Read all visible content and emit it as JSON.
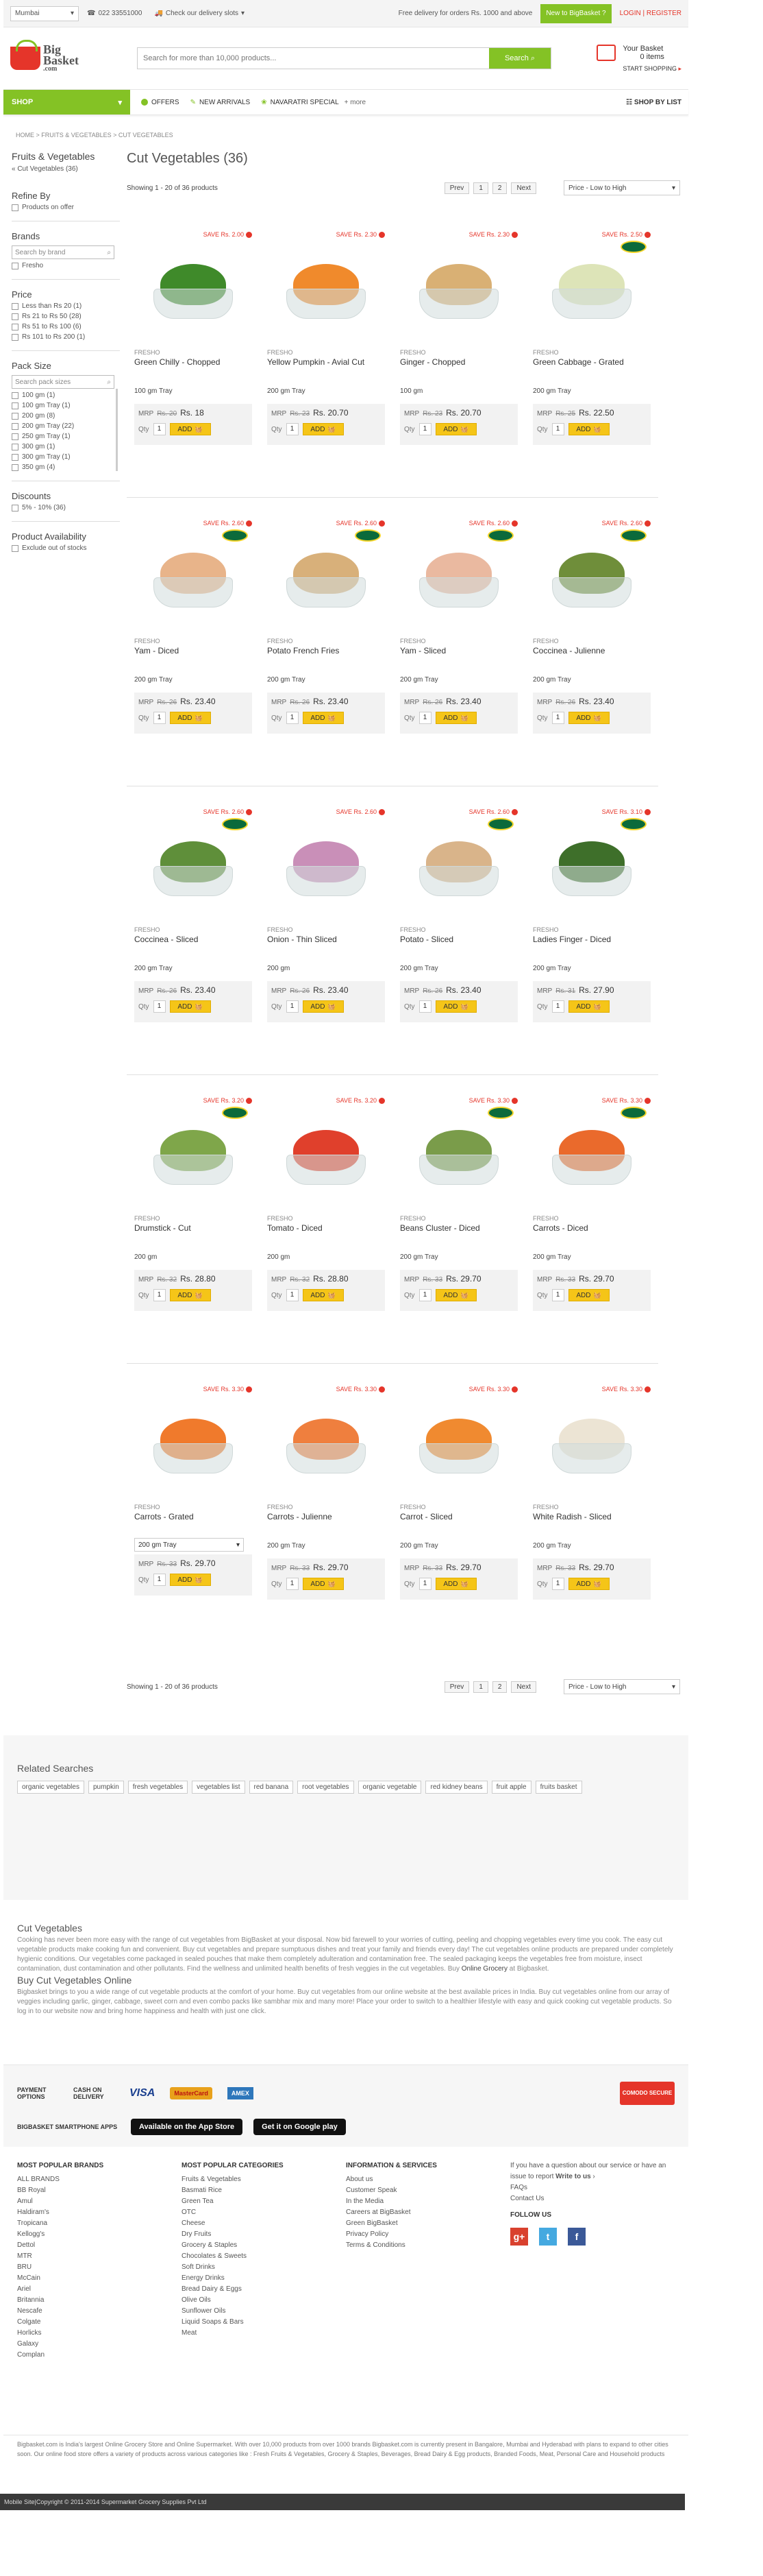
{
  "topbar": {
    "city": "Mumbai",
    "phone": "022 33551000",
    "delivery": "Check our delivery slots",
    "free": "Free delivery for orders Rs. 1000 and above",
    "new_btn": "New to BigBasket ?",
    "login": "LOGIN",
    "sep": " | ",
    "register": "REGISTER"
  },
  "logo": {
    "line1": "Big",
    "line2": "Basket",
    "line3": ".com"
  },
  "search": {
    "placeholder": "Search for more than 10,000 products...",
    "button": "Search"
  },
  "cart": {
    "title": "Your Basket",
    "items": "0 items",
    "start": "START SHOPPING"
  },
  "nav": {
    "shop": "SHOP",
    "offers": "OFFERS",
    "arrivals": "NEW ARRIVALS",
    "special": "NAVARATRI SPECIAL",
    "more": "+ more",
    "list": "SHOP BY LIST"
  },
  "breadcrumb": {
    "home": "HOME",
    "cat": "FRUITS & VEGETABLES",
    "sub": "CUT VEGETABLES",
    "sep": " > "
  },
  "sidebar": {
    "title": "Fruits & Vegetables",
    "sub": "« Cut Vegetables (36)",
    "refine": "Refine By",
    "offer": "Products on offer",
    "brands": "Brands",
    "brand_search": "Search by brand",
    "brand_list": [
      "Fresho"
    ],
    "price": "Price",
    "prices": [
      "Less than Rs 20 (1)",
      "Rs 21 to Rs 50 (28)",
      "Rs 51 to Rs 100 (6)",
      "Rs 101 to Rs 200 (1)"
    ],
    "pack": "Pack Size",
    "pack_search": "Search pack sizes",
    "packs": [
      "100 gm (1)",
      "100 gm Tray (1)",
      "200 gm (8)",
      "200 gm Tray (22)",
      "250 gm Tray (1)",
      "300 gm (1)",
      "300 gm Tray (1)",
      "350 gm (4)"
    ],
    "discounts": "Discounts",
    "discount_list": [
      "5% - 10% (36)"
    ],
    "avail": "Product Availability",
    "exclude": "Exclude out of stocks"
  },
  "content": {
    "title": "Cut Vegetables (36)",
    "showing": "Showing 1 - 20 of 36 products",
    "prev": "Prev",
    "p1": "1",
    "p2": "2",
    "next": "Next",
    "sort": "Price - Low to High"
  },
  "labels": {
    "mrp": "MRP",
    "qty": "Qty",
    "qty_val": "1",
    "add": "ADD"
  },
  "products": [
    {
      "save": "SAVE Rs. 2.00",
      "brand": "FRESHO",
      "name": "Green Chilly - Chopped",
      "size": "100 gm Tray",
      "mrp": "Rs. 20",
      "price": "Rs. 18",
      "color": "#3f8a2a",
      "badge": false
    },
    {
      "save": "SAVE Rs. 2.30",
      "brand": "FRESHO",
      "name": "Yellow Pumpkin - Avial Cut",
      "size": "200 gm Tray",
      "mrp": "Rs. 23",
      "price": "Rs. 20.70",
      "color": "#f08a2c",
      "badge": false
    },
    {
      "save": "SAVE Rs. 2.30",
      "brand": "FRESHO",
      "name": "Ginger - Chopped",
      "size": "100 gm",
      "mrp": "Rs. 23",
      "price": "Rs. 20.70",
      "color": "#d9b074",
      "badge": false
    },
    {
      "save": "SAVE Rs. 2.50",
      "brand": "FRESHO",
      "name": "Green Cabbage - Grated",
      "size": "200 gm Tray",
      "mrp": "Rs. 25",
      "price": "Rs. 22.50",
      "color": "#dde4b8",
      "badge": true
    },
    {
      "save": "SAVE Rs. 2.60",
      "brand": "FRESHO",
      "name": "Yam - Diced",
      "size": "200 gm Tray",
      "mrp": "Rs. 26",
      "price": "Rs. 23.40",
      "color": "#e8b48a",
      "badge": true
    },
    {
      "save": "SAVE Rs. 2.60",
      "brand": "FRESHO",
      "name": "Potato French Fries",
      "size": "200 gm Tray",
      "mrp": "Rs. 26",
      "price": "Rs. 23.40",
      "color": "#d8b07a",
      "badge": true
    },
    {
      "save": "SAVE Rs. 2.60",
      "brand": "FRESHO",
      "name": "Yam - Sliced",
      "size": "200 gm Tray",
      "mrp": "Rs. 26",
      "price": "Rs. 23.40",
      "color": "#eab9a0",
      "badge": true
    },
    {
      "save": "SAVE Rs. 2.60",
      "brand": "FRESHO",
      "name": "Coccinea - Julienne",
      "size": "200 gm Tray",
      "mrp": "Rs. 26",
      "price": "Rs. 23.40",
      "color": "#6f8e3a",
      "badge": true
    },
    {
      "save": "SAVE Rs. 2.60",
      "brand": "FRESHO",
      "name": "Coccinea - Sliced",
      "size": "200 gm Tray",
      "mrp": "Rs. 26",
      "price": "Rs. 23.40",
      "color": "#5f8f3a",
      "badge": true
    },
    {
      "save": "SAVE Rs. 2.60",
      "brand": "FRESHO",
      "name": "Onion - Thin Sliced",
      "size": "200 gm",
      "mrp": "Rs. 26",
      "price": "Rs. 23.40",
      "color": "#c98fb8",
      "badge": false
    },
    {
      "save": "SAVE Rs. 2.60",
      "brand": "FRESHO",
      "name": "Potato - Sliced",
      "size": "200 gm Tray",
      "mrp": "Rs. 26",
      "price": "Rs. 23.40",
      "color": "#d9b48a",
      "badge": true
    },
    {
      "save": "SAVE Rs. 3.10",
      "brand": "FRESHO",
      "name": "Ladies Finger - Diced",
      "size": "200 gm Tray",
      "mrp": "Rs. 31",
      "price": "Rs. 27.90",
      "color": "#3e6f2a",
      "badge": true
    },
    {
      "save": "SAVE Rs. 3.20",
      "brand": "FRESHO",
      "name": "Drumstick - Cut",
      "size": "200 gm",
      "mrp": "Rs. 32",
      "price": "Rs. 28.80",
      "color": "#7fa64a",
      "badge": true
    },
    {
      "save": "SAVE Rs. 3.20",
      "brand": "FRESHO",
      "name": "Tomato - Diced",
      "size": "200 gm",
      "mrp": "Rs. 32",
      "price": "Rs. 28.80",
      "color": "#e0402c",
      "badge": false
    },
    {
      "save": "SAVE Rs. 3.30",
      "brand": "FRESHO",
      "name": "Beans Cluster - Diced",
      "size": "200 gm Tray",
      "mrp": "Rs. 33",
      "price": "Rs. 29.70",
      "color": "#7a9c4a",
      "badge": true
    },
    {
      "save": "SAVE Rs. 3.30",
      "brand": "FRESHO",
      "name": "Carrots - Diced",
      "size": "200 gm Tray",
      "mrp": "Rs. 33",
      "price": "Rs. 29.70",
      "color": "#ea6a2c",
      "badge": true
    },
    {
      "save": "SAVE Rs. 3.30",
      "brand": "FRESHO",
      "name": "Carrots - Grated",
      "size": "200 gm Tray",
      "mrp": "Rs. 33",
      "price": "Rs. 29.70",
      "color": "#f07a2c",
      "badge": false,
      "select": true
    },
    {
      "save": "SAVE Rs. 3.30",
      "brand": "FRESHO",
      "name": "Carrots - Julienne",
      "size": "200 gm Tray",
      "mrp": "Rs. 33",
      "price": "Rs. 29.70",
      "color": "#ef7f3e",
      "badge": false
    },
    {
      "save": "SAVE Rs. 3.30",
      "brand": "FRESHO",
      "name": "Carrot - Sliced",
      "size": "200 gm Tray",
      "mrp": "Rs. 33",
      "price": "Rs. 29.70",
      "color": "#f08a30",
      "badge": false
    },
    {
      "save": "SAVE Rs. 3.30",
      "brand": "FRESHO",
      "name": "White Radish - Sliced",
      "size": "200 gm Tray",
      "mrp": "Rs. 33",
      "price": "Rs. 29.70",
      "color": "#ece4d4",
      "badge": false
    }
  ],
  "related": {
    "title": "Related Searches",
    "tags": [
      "organic vegetables",
      "pumpkin",
      "fresh vegetables",
      "vegetables list",
      "red banana",
      "root vegetables",
      "organic vegetable",
      "red kidney beans",
      "fruit apple",
      "fruits basket"
    ]
  },
  "about": {
    "title1": "Cut Vegetables",
    "text1": "Cooking has never been more easy with the range of cut vegetables from BigBasket at your disposal. Now bid farewell to your worries of cutting, peeling and chopping vegetables every time you cook. The easy cut vegetable products make cooking fun and convenient. Buy cut vegetables and prepare sumptuous dishes and treat your family and friends every day! The cut vegetables online products are prepared under completely hygienic conditions. Our vegetables come packaged in sealed pouches that make them completely adulteration and contamination free. The sealed packaging keeps the vegetables free from moisture, insect contamination, dust contamination and other pollutants. Find the wellness and unlimited health benefits of fresh veggies in the cut vegetables. Buy",
    "link1": "Online Grocery",
    "text1b": " at Bigbasket.",
    "title2": "Buy Cut Vegetables Online",
    "text2": "Bigbasket brings to you a wide range of cut vegetable products at the comfort of your home. Buy cut vegetables from our online website at the best available prices in India. Buy cut vegetables online from our array of veggies including garlic, ginger, cabbage, sweet corn and even combo packs like sambhar mix and many more! Place your order to switch to a healthier lifestyle with easy and quick cooking cut vegetable products. So log in to our website now and bring home happiness and health with just one click."
  },
  "payment": {
    "label": "PAYMENT OPTIONS",
    "cod": "CASH ON DELIVERY",
    "visa": "VISA",
    "mc": "MasterCard",
    "amex": "AMEX",
    "secure": "COMODO SECURE",
    "apps": "BIGBASKET SMARTPHONE APPS",
    "appstore": "Available on the App Store",
    "play": "Get it on Google play"
  },
  "footer": {
    "brands_title": "MOST POPULAR BRANDS",
    "brands": [
      "ALL BRANDS",
      "BB Royal",
      "Amul",
      "Haldiram's",
      "Tropicana",
      "Kellogg's",
      "Dettol",
      "MTR",
      "BRU",
      "McCain",
      "Ariel",
      "Britannia",
      "Nescafe",
      "Colgate",
      "Horlicks",
      "Galaxy",
      "Complan"
    ],
    "cats_title": "MOST POPULAR CATEGORIES",
    "cats": [
      "Fruits & Vegetables",
      "Basmati Rice",
      "Green Tea",
      "OTC",
      "Cheese",
      "Dry Fruits",
      "Grocery & Staples",
      "Chocolates & Sweets",
      "Soft Drinks",
      "Energy Drinks",
      "Bread Dairy & Eggs",
      "Olive Oils",
      "Sunflower Oils",
      "Liquid Soaps & Bars",
      "Meat"
    ],
    "info_title": "INFORMATION & SERVICES",
    "info": [
      "About us",
      "Customer Speak",
      "In the Media",
      "Careers at BigBasket",
      "Green BigBasket",
      "Privacy Policy",
      "Terms & Conditions"
    ],
    "question": "If you have a question about our service or have an issue to report",
    "write": "Write to us",
    "faq": "FAQs",
    "contact": "Contact Us",
    "follow": "FOLLOW US"
  },
  "legal": "Bigbasket.com is India's largest Online Grocery Store and Online Supermarket. With over 10,000 products from over 1000 brands Bigbasket.com is currently present in Bangalore, Mumbai and Hyderabad with plans to expand to other cities soon. Our online food store offers a variety of products across various categories like : Fresh Fruits & Vegetables, Grocery & Staples, Beverages, Bread Dairy & Egg products, Branded Foods, Meat, Personal Care and Household products",
  "copyright": {
    "mobile": "Mobile Site",
    "sep": " | ",
    "text": "Copyright © 2011-2014 Supermarket Grocery Supplies Pvt Ltd"
  }
}
